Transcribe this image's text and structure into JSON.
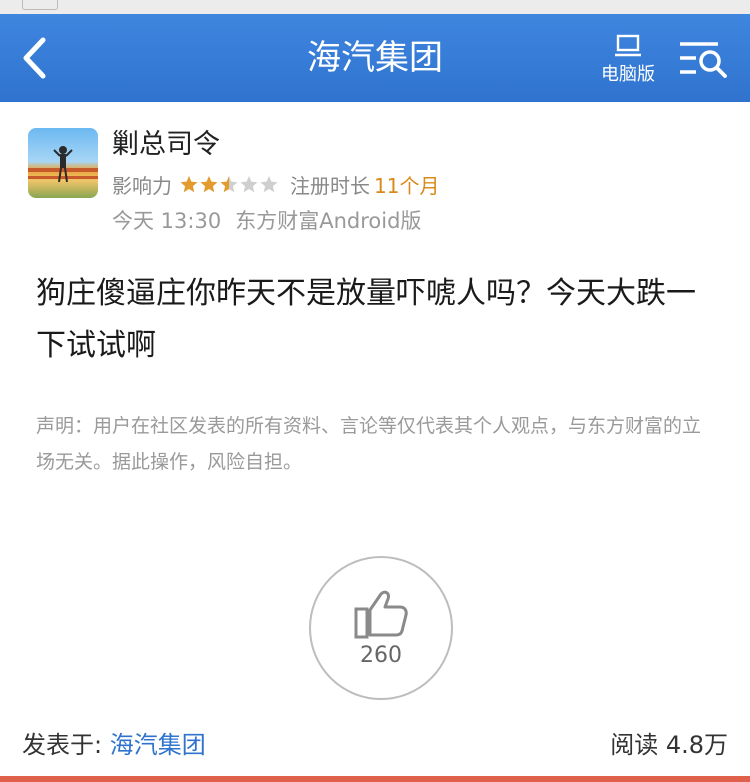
{
  "nav": {
    "title": "海汽集团",
    "pc_label": "电脑版"
  },
  "post": {
    "author": "剿总司令",
    "influence_label": "影响力",
    "influence_stars": 2.5,
    "influence_max": 5,
    "registered_label": "注册时长",
    "registered_value": "11个月",
    "time": "今天 13:30",
    "source": "东方财富Android版",
    "body": "狗庄傻逼庄你昨天不是放量吓唬人吗？今天大跌一下试试啊",
    "disclaimer": "声明：用户在社区发表的所有资料、言论等仅代表其个人观点，与东方财富的立场无关。据此操作，风险自担。",
    "likes": "260"
  },
  "footer": {
    "posted_in_label": "发表于:",
    "forum": "海汽集团",
    "reads": "阅读 4.8万"
  },
  "colors": {
    "nav_bg": "#2f73cf",
    "star_on": "#e39b2e",
    "star_off": "#cfcfcf",
    "accent_orange": "#d98a1a",
    "link_blue": "#2f73cf"
  }
}
